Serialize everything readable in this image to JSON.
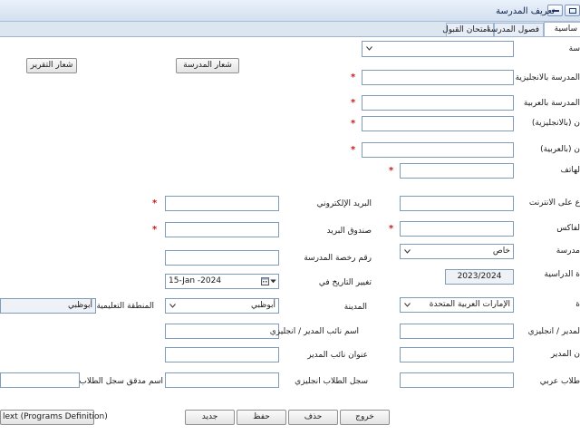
{
  "window": {
    "title": "تعريف المدرسة"
  },
  "tabs": [
    {
      "label": "ساسية",
      "active": true
    },
    {
      "label": "فصول المدرسة",
      "active": false
    },
    {
      "label": "امتحان القبول",
      "active": false
    }
  ],
  "form": {
    "right": {
      "school_type_label": "سة",
      "school_name_en_label": "المدرسة بالانجليزية",
      "school_name_ar_label": "المدرسة بالعربية",
      "address_en_label": "ن (بالانجليزية)",
      "address_ar_label": "ن (بالعربية)",
      "phone_label": "لهاتف",
      "website_label": "ع على الانترنت",
      "fax_label": "لفاكس",
      "ownership_label": "مدرسة",
      "ownership_value": "خاص",
      "academic_year_label": "ة الدراسية",
      "academic_year_value": "2023/2024",
      "country_label": "ة",
      "country_value": "الإمارات العربية المتحدة",
      "principal_en_label": "لمدير / انجليزي",
      "principal_title_label": "ن المدير",
      "students_ar_label": "طلاب عربي"
    },
    "middle": {
      "email_label": "البريد الإلكتروني",
      "po_box_label": "صندوق البريد",
      "license_no_label": "رقم رخصة المدرسة",
      "change_date_label": "تغيير التاريخ في",
      "change_date_value": "15-Jan -2024",
      "city_label": "المدينة",
      "city_value": "أبوظبي",
      "vice_principal_en_label": "اسم نائب المدير / انجليزي",
      "vice_principal_title_label": "عنوان نائب المدير",
      "students_en_label": "سجل الطلاب انجليزي"
    },
    "left": {
      "edu_zone_label": "المنطقة التعليمية",
      "edu_zone_value": "أبوظبي",
      "auditor_label": "اسم مدقق سجل الطلاب"
    },
    "required_mark": "*"
  },
  "buttons": {
    "school_logo": "شعار المدرسة",
    "report_logo": "شعار التقرير",
    "exit": "خروج",
    "delete": "حذف",
    "save": "حفظ",
    "new": "جديد",
    "next": "lext (Programs Definition)"
  }
}
